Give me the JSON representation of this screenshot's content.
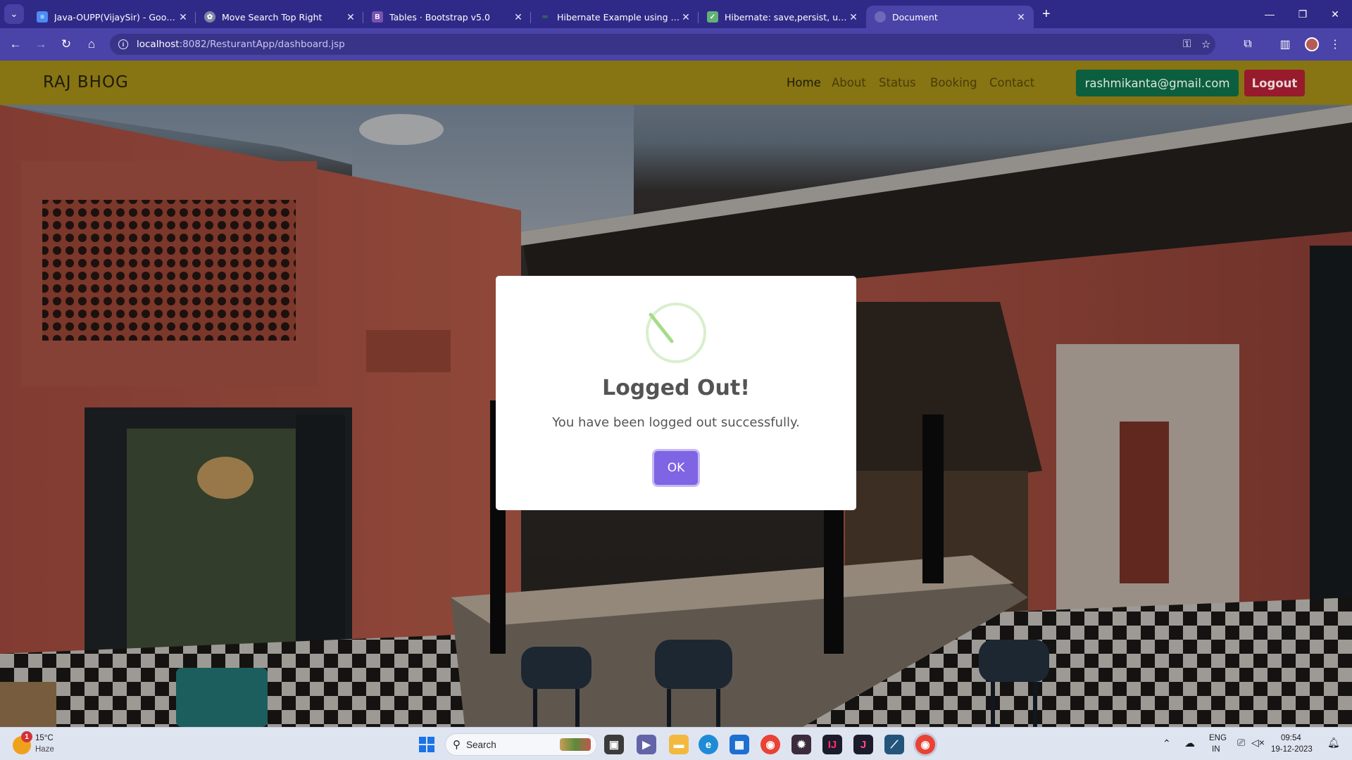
{
  "browser": {
    "tabs": [
      {
        "title": "Java-OUPP(VijaySir) - Google D",
        "favicon": "google-docs-icon",
        "color": "#4c8bf5"
      },
      {
        "title": "Move Search Top Right",
        "favicon": "chatgpt-icon",
        "color": "#a7b1c8"
      },
      {
        "title": "Tables · Bootstrap v5.0",
        "favicon": "bootstrap-icon",
        "color": "#7952b3"
      },
      {
        "title": "Hibernate Example using JPA an",
        "favicon": "gfg-icon",
        "color": "#2f8d46"
      },
      {
        "title": "Hibernate: save,persist, update,",
        "favicon": "baeldung-icon",
        "color": "#63b175"
      },
      {
        "title": "Document",
        "favicon": "globe-icon",
        "color": "#8a86c9"
      }
    ],
    "url_host": "localhost",
    "url_rest": ":8082/ResturantApp/dashboard.jsp"
  },
  "site": {
    "brand": "RAJ BHOG",
    "nav": [
      "Home",
      "About",
      "Status",
      "Booking",
      "Contact"
    ],
    "email_button": "rashmikanta@gmail.com",
    "logout_button": "Logout"
  },
  "modal": {
    "title": "Logged Out!",
    "text": "You have been logged out successfully.",
    "ok_label": "OK",
    "icon": "success-check-icon"
  },
  "taskbar": {
    "weather_temp": "15°C",
    "weather_desc": "Haze",
    "weather_badge": "1",
    "search_label": "Search",
    "lang": "ENG",
    "region": "IN",
    "time": "09:54",
    "date": "19-12-2023"
  },
  "colors": {
    "navbar": "#8e7a14",
    "email_button": "#0c6441",
    "logout_button": "#a01b2f",
    "ok_button": "#7f64e4"
  }
}
